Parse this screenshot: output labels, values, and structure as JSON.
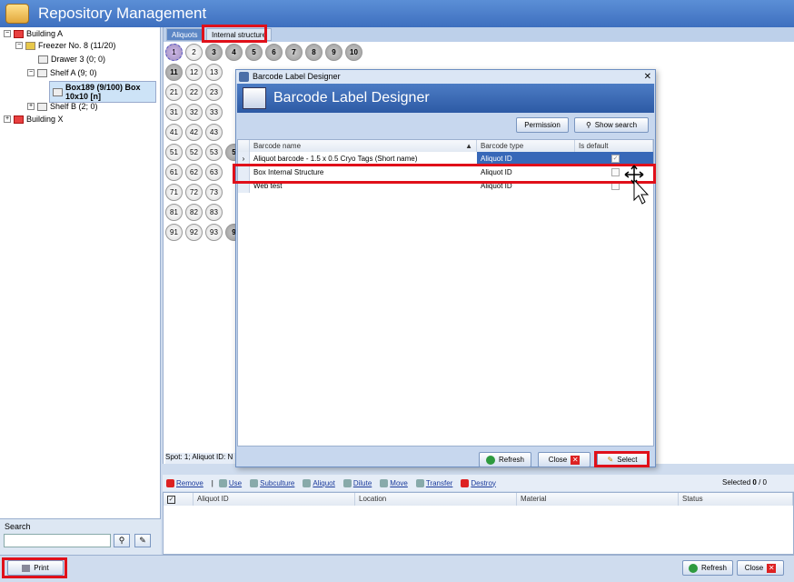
{
  "app": {
    "title": "Repository Management"
  },
  "tree": [
    {
      "label": "Building A",
      "icon": "red"
    },
    {
      "label": "Freezer No. 8 (11/20)",
      "icon": "yel"
    },
    {
      "label": "Drawer 3 (0; 0)",
      "icon": "box"
    },
    {
      "label": "Shelf A (9; 0)",
      "icon": "box"
    },
    {
      "label": "Box189 (9/100) Box 10x10 [n]",
      "icon": "box"
    },
    {
      "label": "Shelf B (2; 0)",
      "icon": "box"
    },
    {
      "label": "Building X",
      "icon": "red"
    }
  ],
  "search": {
    "label": "Search",
    "value": ""
  },
  "tabs": [
    {
      "label": "Aliquots"
    },
    {
      "label": "Internal structure"
    }
  ],
  "grid": {
    "filled": [
      1,
      3,
      4,
      5,
      6,
      7,
      8,
      9,
      10,
      11
    ],
    "rows": [
      [
        "1",
        "2",
        "3",
        "4",
        "5",
        "6",
        "7",
        "8",
        "9",
        "10"
      ],
      [
        "11",
        "12",
        "13"
      ],
      [
        "21",
        "22",
        "23"
      ],
      [
        "31",
        "32",
        "33"
      ],
      [
        "41",
        "42",
        "43"
      ],
      [
        "51",
        "52",
        "53",
        "5"
      ],
      [
        "61",
        "62",
        "63"
      ],
      [
        "71",
        "72",
        "73"
      ],
      [
        "81",
        "82",
        "83"
      ],
      [
        "91",
        "92",
        "93",
        "9"
      ]
    ]
  },
  "spot": {
    "text": "Spot: 1; Aliquot ID: N"
  },
  "toolbar": {
    "remove": "Remove",
    "use": "Use",
    "subculture": "Subculture",
    "aliquot": "Aliquot",
    "dilute": "Dilute",
    "move": "Move",
    "transfer": "Transfer",
    "destroy": "Destroy",
    "selected_label": "Selected",
    "selected_count": "0",
    "selected_total": "/ 0"
  },
  "bottom_grid": {
    "headers": [
      "Aliquot ID",
      "Location",
      "Material",
      "Status"
    ]
  },
  "status": {
    "print": "Print",
    "refresh": "Refresh",
    "close": "Close"
  },
  "dialog": {
    "title": "Barcode Label Designer",
    "header": "Barcode Label Designer",
    "permission": "Permission",
    "show_search": "Show search",
    "columns": [
      "Barcode name",
      "Barcode type",
      "Is default"
    ],
    "rows": [
      {
        "name": "Aliquot barcode - 1.5 x 0.5 Cryo Tags (Short name)",
        "type": "Aliquot ID",
        "default": true
      },
      {
        "name": "Box Internal Structure",
        "type": "Aliquot ID",
        "default": false
      },
      {
        "name": "Web test",
        "type": "Aliquot ID",
        "default": false
      }
    ],
    "refresh": "Refresh",
    "close": "Close",
    "select": "Select"
  }
}
